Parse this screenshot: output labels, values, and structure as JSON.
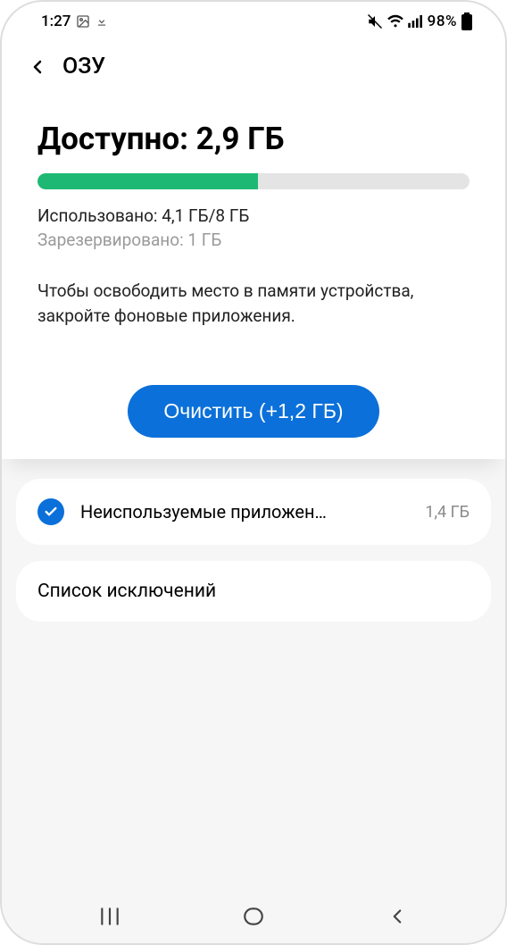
{
  "statusbar": {
    "time": "1:27",
    "battery_pct": "98%"
  },
  "header": {
    "title": "ОЗУ"
  },
  "ram": {
    "available_label": "Доступно: 2,9 ГБ",
    "used_line": "Использовано: 4,1 ГБ/8 ГБ",
    "reserved_line": "Зарезервировано: 1 ГБ",
    "hint": "Чтобы освободить место в памяти устройства, закройте фоновые приложения.",
    "clean_button": "Очистить (+1,2 ГБ)"
  },
  "unused_apps": {
    "label": "Неиспользуемые приложен…",
    "size": "1,4 ГБ"
  },
  "exclusions": {
    "label": "Список исключений"
  },
  "colors": {
    "accent": "#0b70d9",
    "progress": "#1db974"
  }
}
